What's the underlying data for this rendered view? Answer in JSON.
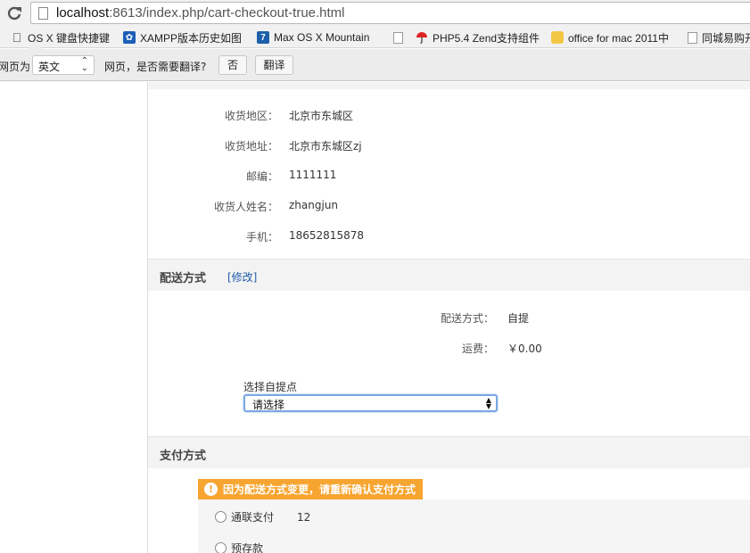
{
  "browser": {
    "url_host": "localhost",
    "url_rest": ":8613/index.php/cart-checkout-true.html",
    "bookmarks": [
      {
        "label": "OS X 键盘快捷键",
        "icon": "apple-icon"
      },
      {
        "label": "XAMPP版本历史如图",
        "icon": "xampp-icon"
      },
      {
        "label": "Max OS X Mountain",
        "icon": "seven-icon"
      },
      {
        "label": "",
        "icon": "document-icon"
      },
      {
        "label": "PHP5.4 Zend支持组件",
        "icon": "umbrella-icon"
      },
      {
        "label": "office for mac 2011中",
        "icon": "office-icon"
      },
      {
        "label": "",
        "icon": "document-icon"
      },
      {
        "label": "同城易购开",
        "icon": "document-icon"
      }
    ],
    "translate_bar": {
      "prefix": "网页为",
      "language": "英文",
      "question": "网页，是否需要翻译?",
      "no_button": "否",
      "translate_button": "翻译"
    }
  },
  "address": {
    "rows": [
      {
        "label": "收货地区：",
        "value": "北京市东城区"
      },
      {
        "label": "收货地址：",
        "value": "北京市东城区zj"
      },
      {
        "label": "邮编：",
        "value": "1111111"
      },
      {
        "label": "收货人姓名：",
        "value": "zhangjun"
      },
      {
        "label": "手机：",
        "value": "18652815878"
      }
    ]
  },
  "shipping": {
    "title": "配送方式",
    "edit_label": "[修改]",
    "method_label": "配送方式：",
    "method_value": "自提",
    "fee_label": "运费：",
    "fee_value": "￥0.00",
    "pickup_label": "选择自提点",
    "pickup_selected": "请选择"
  },
  "payment": {
    "title": "支付方式",
    "notice": "因为配送方式变更，请重新确认支付方式",
    "options": [
      {
        "label": "通联支付",
        "extra": "12"
      },
      {
        "label": "预存款",
        "extra": ""
      }
    ]
  },
  "colors": {
    "notice_bg": "#f7a531",
    "link": "#1d5aa8",
    "section_bg": "#f3f3f3"
  }
}
